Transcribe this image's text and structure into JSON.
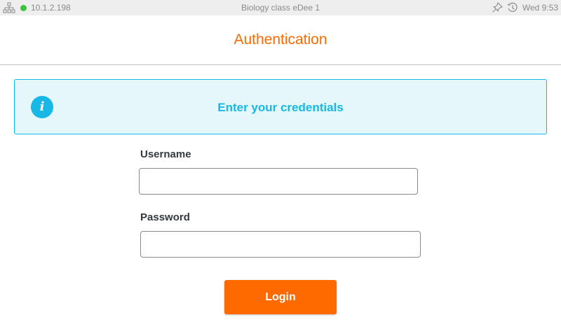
{
  "colors": {
    "accent": "#ff6a00",
    "info": "#17b8e6",
    "info_bg": "#e6f7fb",
    "online": "#3cc43c"
  },
  "status_bar": {
    "network_icon": "network-icon",
    "connection_status": "online",
    "ip": "10.1.2.198",
    "title": "Biology class eDee 1",
    "icons": [
      "pin-icon",
      "clock-icon"
    ],
    "time": "Wed 9:53"
  },
  "header": {
    "title": "Authentication"
  },
  "info_banner": {
    "icon": "info-icon",
    "icon_glyph": "i",
    "message": "Enter your credentials"
  },
  "form": {
    "username_label": "Username",
    "username_value": "",
    "password_label": "Password",
    "password_value": "",
    "login_label": "Login"
  }
}
